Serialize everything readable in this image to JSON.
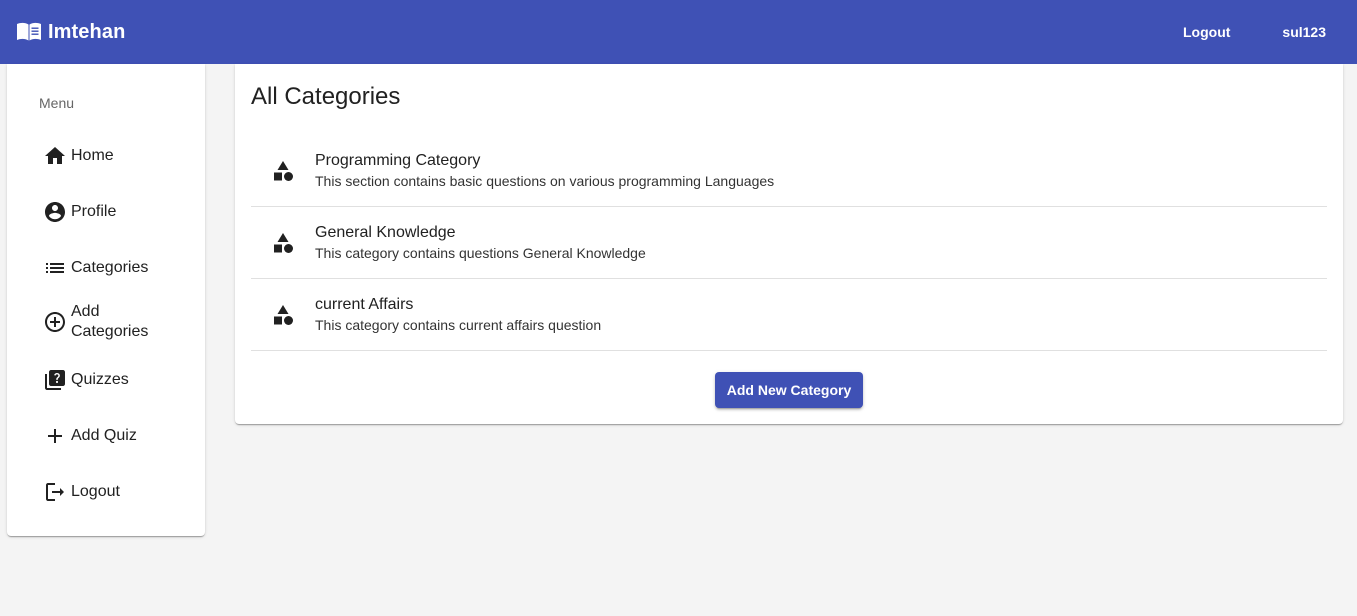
{
  "app": {
    "title": "Imtehan",
    "brand_icon": "menu-book-icon"
  },
  "toolbar": {
    "logout_label": "Logout",
    "username": "sul123"
  },
  "colors": {
    "primary": "#3f51b5",
    "background": "#f4f4f4"
  },
  "sidebar": {
    "header": "Menu",
    "items": [
      {
        "label": "Home",
        "icon": "home-icon"
      },
      {
        "label": "Profile",
        "icon": "account-circle-icon"
      },
      {
        "label": "Categories",
        "icon": "list-icon"
      },
      {
        "label": "Add Categories",
        "icon": "add-circle-outline-icon"
      },
      {
        "label": "Quizzes",
        "icon": "quiz-icon"
      },
      {
        "label": "Add Quiz",
        "icon": "add-icon"
      },
      {
        "label": "Logout",
        "icon": "logout-icon"
      }
    ]
  },
  "main": {
    "title": "All Categories",
    "categories": [
      {
        "title": "Programming Category",
        "description": "This section contains basic questions on various programming Languages",
        "icon": "category-icon"
      },
      {
        "title": "General Knowledge",
        "description": "This category contains questions General Knowledge",
        "icon": "category-icon"
      },
      {
        "title": "current Affairs",
        "description": "This category contains current affairs question",
        "icon": "category-icon"
      }
    ],
    "add_button_label": "Add New Category"
  }
}
